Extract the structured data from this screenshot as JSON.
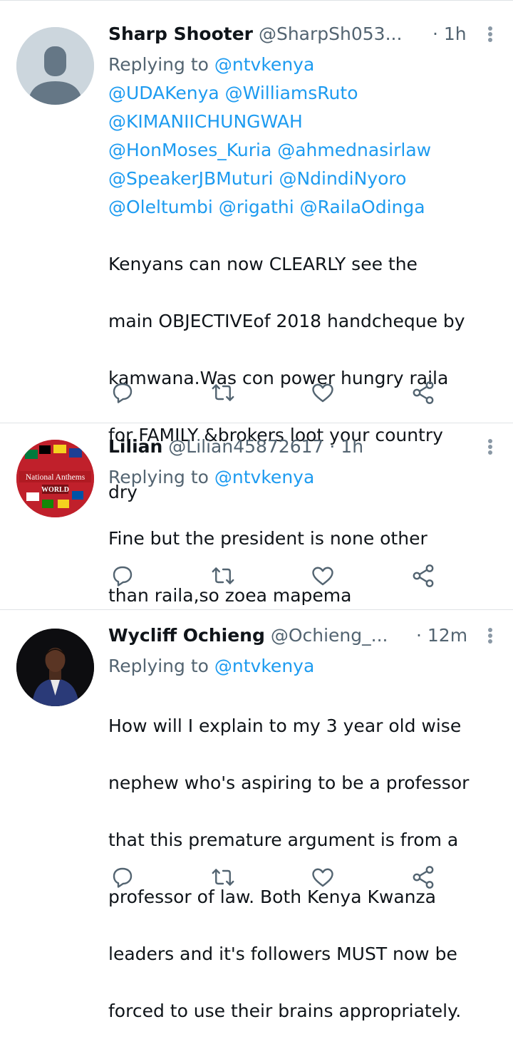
{
  "tweets": [
    {
      "name": "Sharp Shooter",
      "handle": "@SharpSh053...",
      "time": "· 1h",
      "replying_label": "Replying to",
      "replying_handle": "@ntvkenya",
      "mentions": [
        "@UDAKenya @WilliamsRuto",
        "@KIMANIICHUNGWAH",
        "@HonMoses_Kuria @ahmednasirlaw",
        "@SpeakerJBMuturi @NdindiNyoro",
        "@Oleltumbi @rigathi @RailaOdinga"
      ],
      "text_lines": [
        "Kenyans can now CLEARLY see the",
        "main OBJECTIVEof 2018 handcheque by",
        "kamwana.Was con power hungry raila",
        "for FAMILY &brokers loot your country",
        "dry"
      ],
      "avatar": "default-avatar"
    },
    {
      "name": "Lilian",
      "handle": "@Lilian45872617",
      "time": "· 1h",
      "replying_label": "Replying to",
      "replying_handle": "@ntvkenya",
      "text_lines": [
        "Fine but the president is none other",
        "than raila,so zoea mapema"
      ],
      "avatar": "national-anthems-logo",
      "avatar_text": {
        "line1": "National Anthems",
        "line2": "WORLD"
      }
    },
    {
      "name": "Wycliff Ochieng",
      "handle": "@Ochieng_...",
      "time": "· 12m",
      "replying_label": "Replying to",
      "replying_handle": "@ntvkenya",
      "text_lines": [
        "How will I explain to my 3 year old wise",
        "nephew who's aspiring to be a professor",
        "that this premature argument is from a",
        "professor of law. Both Kenya Kwanza",
        "leaders and it's followers MUST now be",
        "forced to use their brains appropriately."
      ],
      "avatar": "user-photo"
    }
  ],
  "colors": {
    "link": "#1d9bf0",
    "secondary": "#536471",
    "icon": "#536471",
    "divider": "#dfe3e6"
  },
  "action_icons": [
    "reply-icon",
    "retweet-icon",
    "like-icon",
    "share-icon"
  ]
}
